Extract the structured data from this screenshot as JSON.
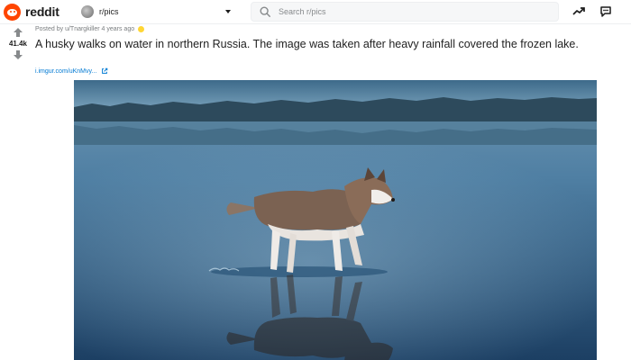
{
  "header": {
    "logo_text": "reddit",
    "community": "r/pics",
    "search_placeholder": "Search r/pics",
    "icons": [
      "popular-icon",
      "chat-icon"
    ]
  },
  "post": {
    "score": "41.4k",
    "meta": "Posted by u/Tnargkiller 4 years ago",
    "title": "A husky walks on water in northern Russia. The image was taken after heavy rainfall covered the frozen lake.",
    "link": "i.imgur.com/uKnMvy...",
    "image_subject": "husky-on-frozen-lake-photo"
  },
  "colors": {
    "brand": "#ff4500",
    "link": "#0079d3",
    "muted": "#787c7e"
  }
}
